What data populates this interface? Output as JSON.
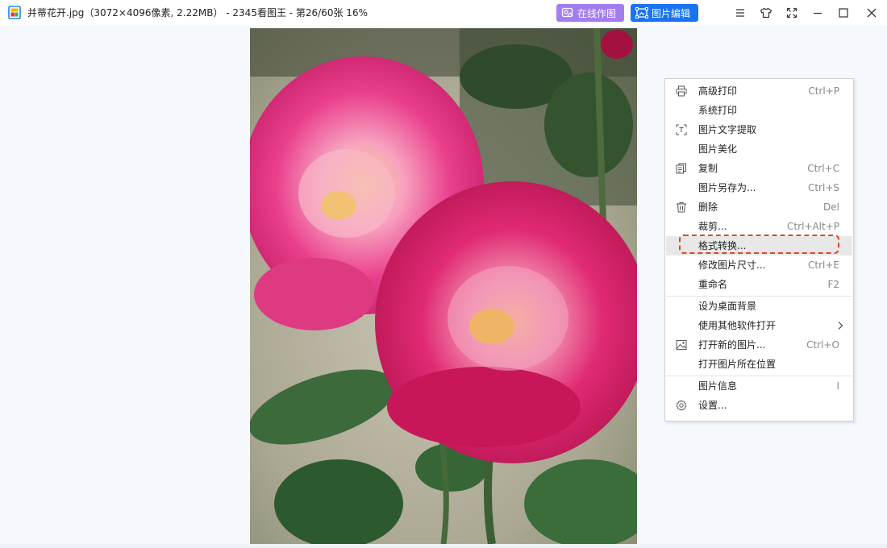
{
  "window": {
    "title": "并蒂花开.jpg（3072×4096像素, 2.22MB） - 2345看图王 - 第26/60张 16%",
    "online_design_label": "在线作图",
    "image_edit_label": "图片编辑",
    "accent_purple": "#a37df0",
    "accent_blue": "#1a74f0"
  },
  "context_menu": {
    "highlight_color": "#d84a2c",
    "items": [
      {
        "label": "高级打印",
        "shortcut": "Ctrl+P",
        "icon": "printer-icon"
      },
      {
        "label": "系统打印",
        "shortcut": "",
        "icon": ""
      },
      {
        "label": "图片文字提取",
        "shortcut": "",
        "icon": "text-extract-icon"
      },
      {
        "label": "图片美化",
        "shortcut": "",
        "icon": ""
      },
      {
        "label": "复制",
        "shortcut": "Ctrl+C",
        "icon": "copy-icon"
      },
      {
        "label": "图片另存为...",
        "shortcut": "Ctrl+S",
        "icon": ""
      },
      {
        "label": "删除",
        "shortcut": "Del",
        "icon": "trash-icon"
      },
      {
        "label": "裁剪...",
        "shortcut": "Ctrl+Alt+P",
        "icon": ""
      },
      {
        "label": "格式转换...",
        "shortcut": "",
        "icon": "",
        "highlighted": true
      },
      {
        "label": "修改图片尺寸...",
        "shortcut": "Ctrl+E",
        "icon": ""
      },
      {
        "label": "重命名",
        "shortcut": "F2",
        "icon": ""
      },
      {
        "label": "设为桌面背景",
        "shortcut": "",
        "icon": ""
      },
      {
        "label": "使用其他软件打开",
        "shortcut": "",
        "icon": "",
        "submenu": true
      },
      {
        "label": "打开新的图片...",
        "shortcut": "Ctrl+O",
        "icon": "image-icon"
      },
      {
        "label": "打开图片所在位置",
        "shortcut": "",
        "icon": ""
      },
      {
        "label": "图片信息",
        "shortcut": "I",
        "icon": ""
      },
      {
        "label": "设置...",
        "shortcut": "",
        "icon": "gear-icon"
      }
    ]
  }
}
